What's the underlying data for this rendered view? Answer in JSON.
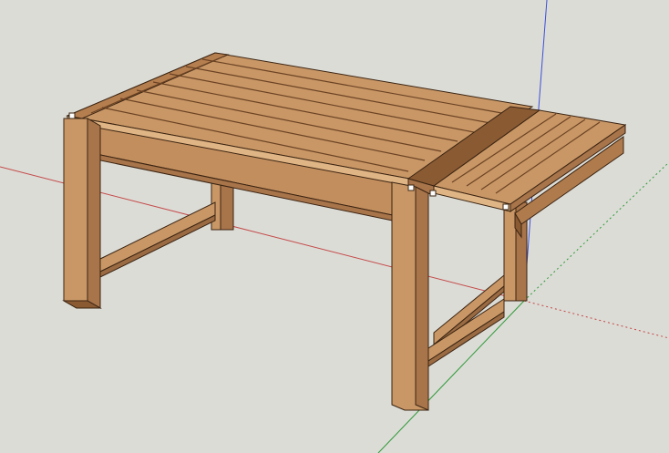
{
  "viewport": {
    "background": "#dcdcd6"
  },
  "axes": {
    "red_axis_color": "#c44a4a",
    "green_axis_color": "#2e9a3a",
    "blue_axis_color": "#3b4fd8"
  },
  "model": {
    "wood_light": "#c99766",
    "wood_mid": "#b07b4c",
    "wood_dark": "#7c4f2c",
    "edge": "#3a2412"
  }
}
